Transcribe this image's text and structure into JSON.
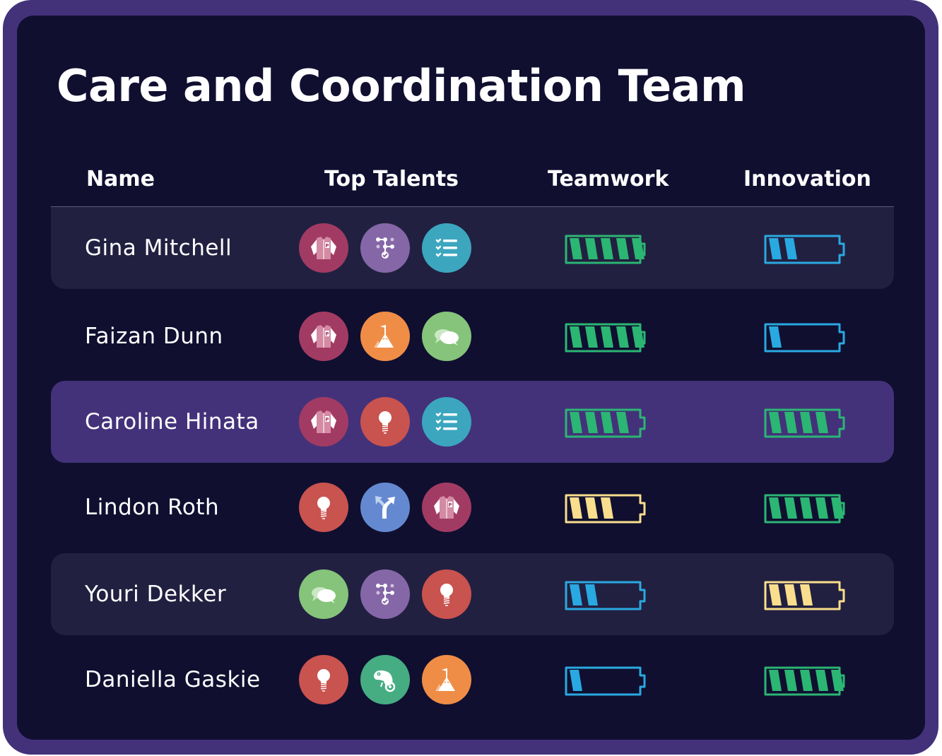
{
  "title": "Care and Coordination Team",
  "columns": {
    "name": "Name",
    "talents": "Top Talents",
    "teamwork": "Teamwork",
    "innovation": "Innovation"
  },
  "battery_max": 5,
  "level_colors": {
    "low": "#29a9e1",
    "medium": "#f9de8d",
    "high": "#2bb673"
  },
  "talent_types": {
    "letterman-jacket": {
      "color": "#a23b63",
      "icon": "letterman-jacket-icon"
    },
    "node-network": {
      "color": "#8567a8",
      "icon": "node-network-icon"
    },
    "checklist": {
      "color": "#3ca6bf",
      "icon": "checklist-icon"
    },
    "mountain-flag": {
      "color": "#ef8d47",
      "icon": "mountain-flag-icon"
    },
    "speech-bubbles": {
      "color": "#85c47a",
      "icon": "speech-bubbles-icon"
    },
    "lightbulb": {
      "color": "#c9534f",
      "icon": "lightbulb-icon"
    },
    "split-arrow": {
      "color": "#6489d1",
      "icon": "split-arrow-icon"
    },
    "chameleon": {
      "color": "#46ad83",
      "icon": "chameleon-icon"
    }
  },
  "rows": [
    {
      "name": "Gina Mitchell",
      "talents": [
        "letterman-jacket",
        "node-network",
        "checklist"
      ],
      "teamwork": 5,
      "innovation": 2,
      "style": "alt"
    },
    {
      "name": "Faizan Dunn",
      "talents": [
        "letterman-jacket",
        "mountain-flag",
        "speech-bubbles"
      ],
      "teamwork": 5,
      "innovation": 1,
      "style": "plain"
    },
    {
      "name": "Caroline Hinata",
      "talents": [
        "letterman-jacket",
        "lightbulb",
        "checklist"
      ],
      "teamwork": 4,
      "innovation": 4,
      "style": "highlight"
    },
    {
      "name": "Lindon Roth",
      "talents": [
        "lightbulb",
        "split-arrow",
        "letterman-jacket"
      ],
      "teamwork": 3,
      "innovation": 5,
      "style": "plain"
    },
    {
      "name": "Youri Dekker",
      "talents": [
        "speech-bubbles",
        "node-network",
        "lightbulb"
      ],
      "teamwork": 2,
      "innovation": 3,
      "style": "alt"
    },
    {
      "name": "Daniella Gaskie",
      "talents": [
        "lightbulb",
        "chameleon",
        "mountain-flag"
      ],
      "teamwork": 1,
      "innovation": 5,
      "style": "plain"
    }
  ]
}
